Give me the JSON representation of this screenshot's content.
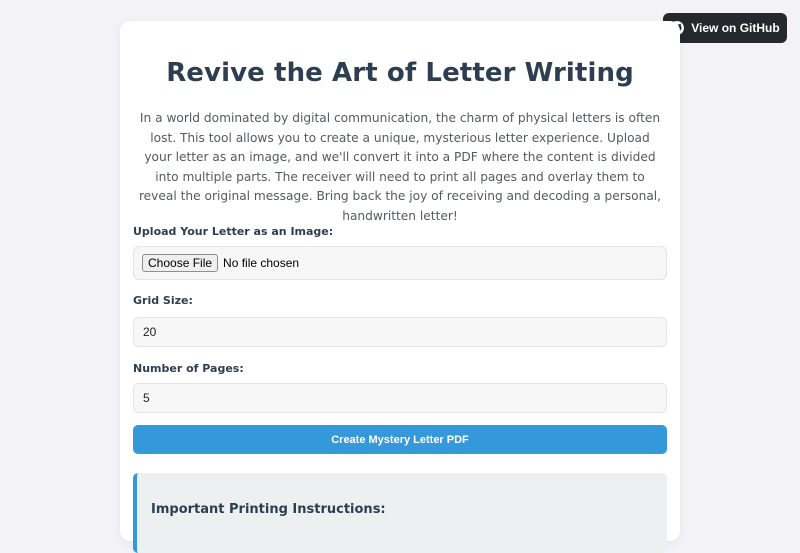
{
  "github_button": {
    "icon": "github-icon",
    "label": "View on GitHub",
    "background": "#24292e"
  },
  "main": {
    "title": "Revive the Art of Letter Writing",
    "intro": "In a world dominated by digital communication, the charm of physical letters is often lost. This tool allows you to create a unique, mysterious letter experience. Upload your letter as an image, and we'll convert it into a PDF where the content is divided into multiple parts. The receiver will need to print all pages and overlay them to reveal the original message. Bring back the joy of receiving and decoding a personal, handwritten letter!"
  },
  "form": {
    "upload_label": "Upload Your Letter as an Image:",
    "choose_file_label": "Choose File",
    "no_file_text": "No file chosen",
    "grid_size_label": "Grid Size:",
    "grid_size_value": "20",
    "pages_label": "Number of Pages:",
    "pages_value": "5",
    "submit_label": "Create Mystery Letter PDF"
  },
  "instructions": {
    "title": "Important Printing Instructions:"
  },
  "colors": {
    "accent": "#3498db",
    "heading": "#2c3e50",
    "page_background": "#f3f2f7"
  }
}
